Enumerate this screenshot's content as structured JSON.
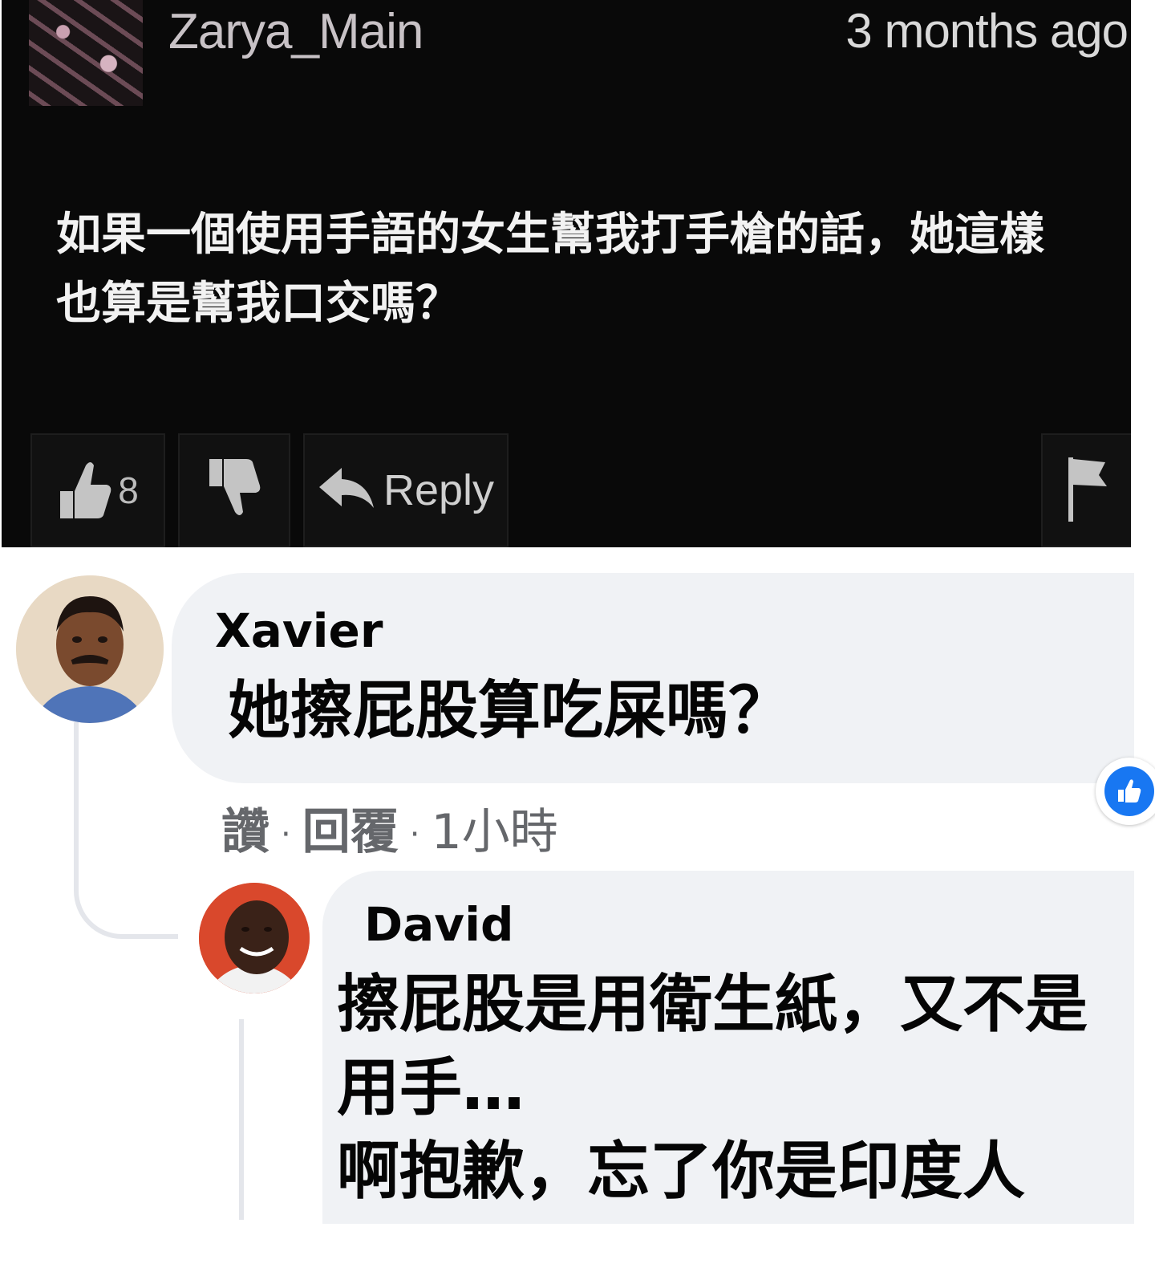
{
  "top_comment": {
    "username": "Zarya_Main",
    "timestamp": "3 months ago",
    "body": "如果一個使用手語的女生幫我打手槍的話，她這樣也算是幫我口交嗎？",
    "like_count": "8",
    "reply_label": "Reply"
  },
  "comments": [
    {
      "author": "Xavier",
      "text": "她擦屁股算吃屎嗎？",
      "actions": {
        "like": "讚",
        "reply": "回覆",
        "time": "1小時"
      }
    },
    {
      "author": "David",
      "text": "擦屁股是用衛生紙，又不是用手…\n啊抱歉，忘了你是印度人"
    }
  ],
  "colors": {
    "dark_bg": "#090909",
    "bubble_bg": "#f0f2f5",
    "meta_text": "#65676b",
    "reaction_blue": "#1877f2"
  }
}
